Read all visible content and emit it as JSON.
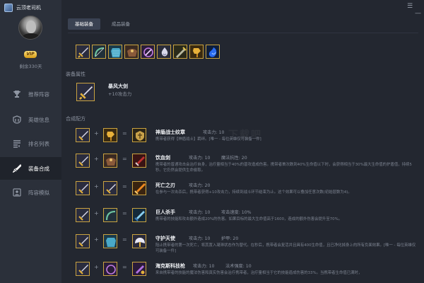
{
  "app": {
    "title": "云顶老司机"
  },
  "user": {
    "vip": "VIP",
    "days": "剩余330天"
  },
  "nav": [
    {
      "label": "推荐阵容",
      "icon": "trophy-icon"
    },
    {
      "label": "英雄信息",
      "icon": "helmet-icon"
    },
    {
      "label": "排名列表",
      "icon": "list-icon"
    },
    {
      "label": "装备合成",
      "icon": "sword-icon",
      "active": true
    },
    {
      "label": "阵容模拟",
      "icon": "person-icon"
    }
  ],
  "tabs": [
    {
      "label": "基础装备",
      "active": true
    },
    {
      "label": "成品装备",
      "active": false
    }
  ],
  "window": {
    "menu": "☰",
    "minimize": "—"
  },
  "basic_items": [
    "暴风大剑",
    "反曲之弓",
    "锁子甲",
    "负极斗篷",
    "无用大棒",
    "女神之泪",
    "巨人腰带",
    "金铲铲",
    "拳套"
  ],
  "attr": {
    "section": "装备属性",
    "name": "暴风大剑",
    "stat": "+10攻击力"
  },
  "recipes": {
    "section": "合成配方",
    "list": [
      {
        "name": "神盾战士纹章",
        "stats": [
          "攻击力: 10"
        ],
        "desc": "携带者获得【神盾战士】羁绊。[唯一 - 每位英雄仅可装备一件]"
      },
      {
        "name": "饮血剑",
        "stats": [
          "攻击力: 10",
          "魔法抗性: 20"
        ],
        "desc": "携带者的普通攻击会治疗自身，治疗量相当于40%的普攻造成伤害。携带者首次跌到40%生命值以下时，会获得相当于30%最大生命值的护盾值，持续5秒。它仍然会提供生命偷取。"
      },
      {
        "name": "死亡之刃",
        "stats": [
          "攻击力: 20"
        ],
        "desc": "在参与一次击杀后，携带者获得+10攻击力，持续到战斗环节结束为止。这个效果可以叠加任意次数(初始层数为4)。"
      },
      {
        "name": "巨人杀手",
        "stats": [
          "攻击力: 10",
          "攻击速度: 10%"
        ],
        "desc": "携带者的技能和攻击额外造成20%的伤害。如果目标的最大生命值高于1600，造成的额外伤害会提升至70%。"
      },
      {
        "name": "守护天使",
        "stats": [
          "攻击力: 10",
          "护甲: 20"
        ],
        "desc": "阻止携带者的第一次死亡，将其置入凝滞状态作为替代。在秒后，携带者会复活并且具有400生命值，且已净化掉身上的所有负面效果。[唯一 - 每位英雄仅可装备一件]"
      },
      {
        "name": "海克斯科技枪",
        "stats": [
          "攻击力: 10",
          "法术强度: 10"
        ],
        "desc": "来自携带者的技能的魔法伤害和真实伤害会治疗携带者，治疗量相当于它的技能造成伤害的33%。当携带者生命值已满时，"
      }
    ]
  },
  "watermark": "下载吧"
}
